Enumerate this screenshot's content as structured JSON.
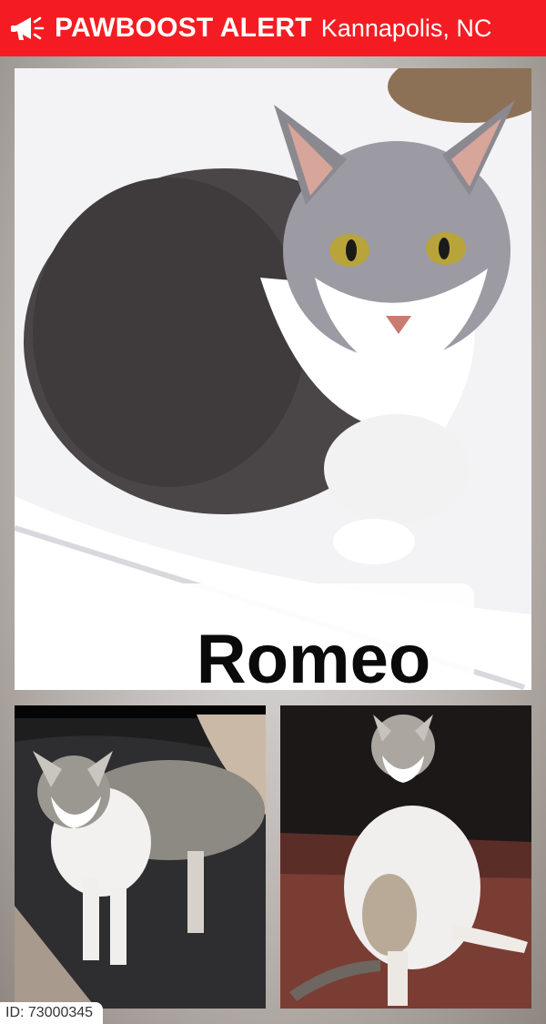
{
  "header": {
    "brand": "PAWBOOST ALERT",
    "location": "Kannapolis, NC",
    "icon": "megaphone-icon",
    "background_color": "#f41c22"
  },
  "main_photo": {
    "caption": "Romeo"
  },
  "footer": {
    "id_text": "ID: 73000345"
  }
}
